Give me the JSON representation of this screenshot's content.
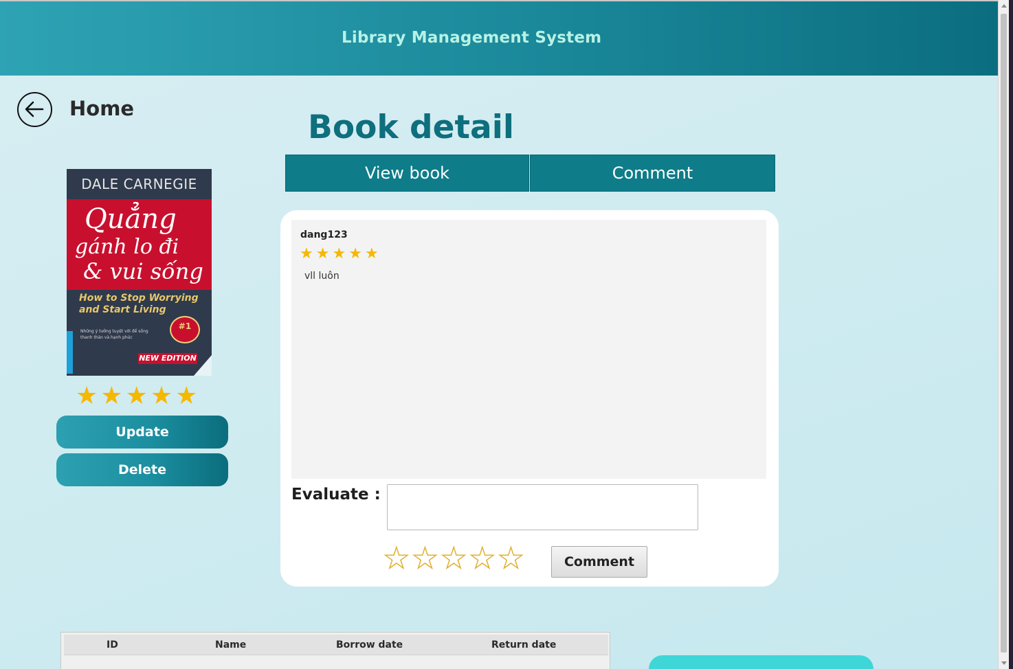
{
  "header": {
    "title": "Library Management System"
  },
  "nav": {
    "back_icon": "arrow-left-circle-icon",
    "home_label": "Home"
  },
  "page_title": "Book detail",
  "tabs": [
    {
      "label": "View book"
    },
    {
      "label": "Comment"
    }
  ],
  "book": {
    "cover": {
      "author": "DALE CARNEGIE",
      "title_line1": "Quẳng",
      "title_line2": "gánh lo đi",
      "title_line3": "& vui sống",
      "subtitle": "How to Stop Worrying and Start Living",
      "small_text": "Những ý tưởng tuyệt vời để sống thanh thản và hạnh phúc",
      "badge": "#1",
      "edition": "NEW EDITION"
    },
    "rating": 5,
    "rating_max": 5
  },
  "actions": {
    "update_label": "Update",
    "delete_label": "Delete"
  },
  "comments": [
    {
      "user": "dang123",
      "rating": 5,
      "text": "vll luôn"
    }
  ],
  "evaluate": {
    "label": "Evaluate :",
    "input_value": "",
    "placeholder": "",
    "rating": 0,
    "rating_max": 5,
    "submit_label": "Comment"
  },
  "borrow_table": {
    "columns": [
      "ID",
      "Name",
      "Borrow date",
      "Return date"
    ],
    "rows": []
  },
  "colors": {
    "header_start": "#2ea3b4",
    "header_end": "#0b6e80",
    "header_title": "#b8f2e6",
    "page_title": "#0e6f7d",
    "tab_bg": "#0e7c89",
    "star": "#f5b800",
    "cyan_button": "#3fd6d8"
  }
}
